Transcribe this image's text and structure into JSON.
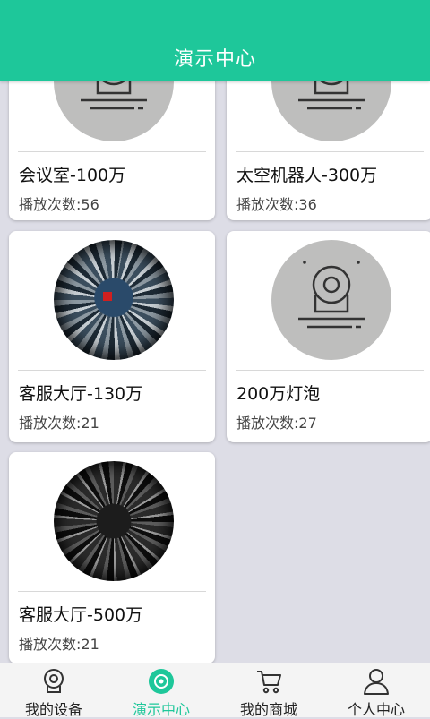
{
  "header": {
    "title": "演示中心"
  },
  "accent_color": "#1ec79a",
  "cards": [
    {
      "name": "会议室-100万",
      "plays": "播放次数:56",
      "thumbnail": "camera-placeholder"
    },
    {
      "name": "太空机器人-300万",
      "plays": "播放次数:36",
      "thumbnail": "camera-placeholder"
    },
    {
      "name": "客服大厅-130万",
      "plays": "播放次数:21",
      "thumbnail": "fisheye-preview"
    },
    {
      "name": "200万灯泡",
      "plays": "播放次数:27",
      "thumbnail": "camera-placeholder"
    },
    {
      "name": "客服大厅-500万",
      "plays": "播放次数:21",
      "thumbnail": "fisheye-preview"
    }
  ],
  "tabs": [
    {
      "label": "我的设备",
      "icon": "camera-icon",
      "active": false
    },
    {
      "label": "演示中心",
      "icon": "demo-icon",
      "active": true
    },
    {
      "label": "我的商城",
      "icon": "cart-icon",
      "active": false
    },
    {
      "label": "个人中心",
      "icon": "person-icon",
      "active": false
    }
  ]
}
